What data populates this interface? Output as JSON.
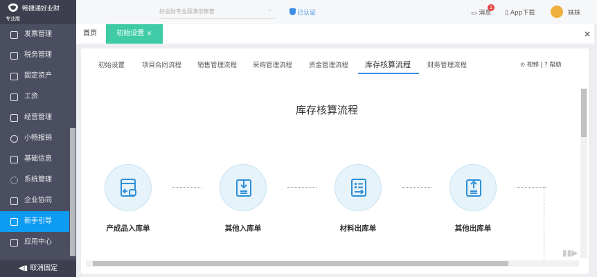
{
  "app": {
    "name": "畅捷通好业财",
    "edition": "专业版"
  },
  "topbar": {
    "account": "好业财专业版演示帐套",
    "verified": "已认证",
    "messages": "消息",
    "message_count": "1",
    "app_download": "App下载",
    "user": "妹妹"
  },
  "sidebar": {
    "items": [
      {
        "label": "发票管理"
      },
      {
        "label": "税务管理"
      },
      {
        "label": "固定资产"
      },
      {
        "label": "工资"
      },
      {
        "label": "经营管理"
      },
      {
        "label": "小畅报销"
      },
      {
        "label": "基础信息"
      },
      {
        "label": "系统管理"
      },
      {
        "label": "企业协同"
      },
      {
        "label": "新手引导",
        "active": true
      },
      {
        "label": "应用中心"
      }
    ],
    "footer": "取消固定"
  },
  "tabs": {
    "home": "首页",
    "current": "初始设置",
    "close": "×"
  },
  "subtabs": [
    "初始设置",
    "项目合同流程",
    "销售管理流程",
    "采购管理流程",
    "资金管理流程",
    "库存核算流程",
    "财务管理流程"
  ],
  "active_subtab": "库存核算流程",
  "links": {
    "video": "视频",
    "help": "帮助"
  },
  "flow": {
    "title": "库存核算流程",
    "nodes": [
      {
        "label": "产成品入库单",
        "icon": "inbound-product-icon"
      },
      {
        "label": "其他入库单",
        "icon": "download-doc-icon"
      },
      {
        "label": "材料出库单",
        "icon": "list-out-icon"
      },
      {
        "label": "其他出库单",
        "icon": "upload-doc-icon"
      }
    ]
  },
  "colors": {
    "accent": "#3ecba5",
    "active": "#0e9cf2",
    "link": "#3a8ee6",
    "icon": "#2e8fd6"
  }
}
